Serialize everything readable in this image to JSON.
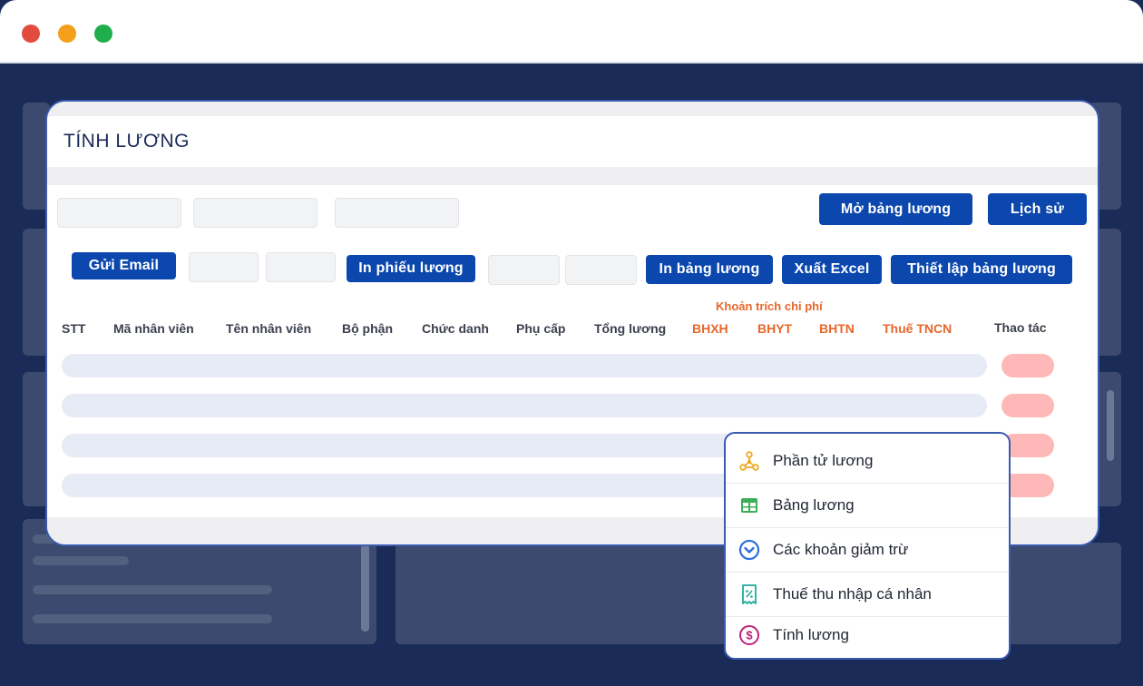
{
  "window_controls": {
    "close_color": "#e34b3f",
    "minimize_color": "#f4a01c",
    "maximize_color": "#1fae4b"
  },
  "page": {
    "title": "TÍNH LƯƠNG"
  },
  "toolbar": {
    "open_payroll": "Mở bảng lương",
    "history": "Lịch sử",
    "send_email": "Gửi Email",
    "print_payslip": "In phiếu lương",
    "print_payroll": "In bảng lương",
    "export_excel": "Xuất Excel",
    "payroll_setup": "Thiết lập bảng lương"
  },
  "table": {
    "group_header": "Khoản trích chi phí",
    "columns": [
      "STT",
      "Mã nhân viên",
      "Tên nhân viên",
      "Bộ phận",
      "Chức danh",
      "Phụ cấp",
      "Tổng lương",
      "BHXH",
      "BHYT",
      "BHTN",
      "Thuế TNCN",
      "Thao tác"
    ]
  },
  "menu": {
    "items": [
      {
        "label": "Phần tử lương",
        "icon": "nodes-icon"
      },
      {
        "label": "Bảng lương",
        "icon": "table-icon"
      },
      {
        "label": "Các khoản giảm trừ",
        "icon": "chevron-circle-icon"
      },
      {
        "label": "Thuế thu nhập cá nhân",
        "icon": "receipt-icon"
      },
      {
        "label": "Tính lương",
        "icon": "dollar-circle-icon"
      }
    ]
  },
  "colors": {
    "brand": "#0b47ad",
    "accent_orange": "#e8672a",
    "background": "#1b2b57"
  }
}
